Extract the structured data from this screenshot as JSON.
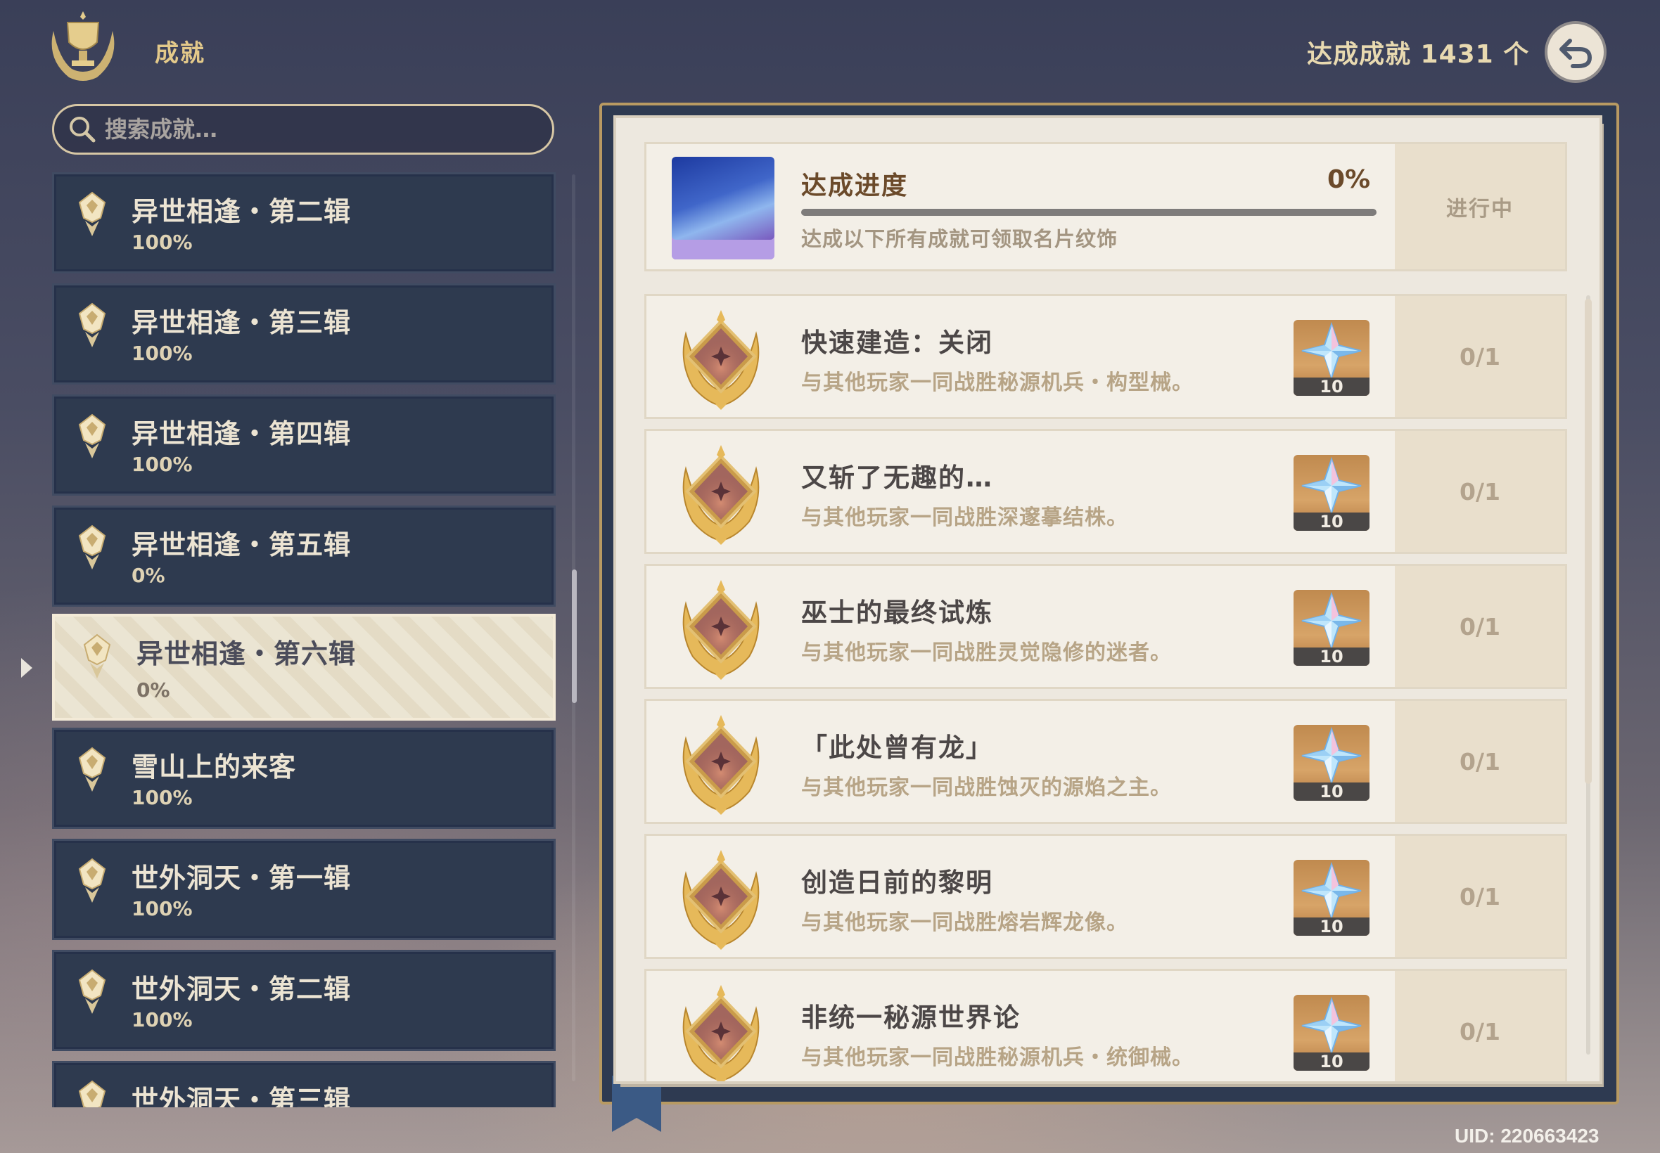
{
  "header": {
    "title": "成就",
    "total_label": "达成成就 1431 个"
  },
  "search": {
    "placeholder": "搜索成就…"
  },
  "categories": [
    {
      "name": "异世相逢・第二辑",
      "percent": "100%"
    },
    {
      "name": "异世相逢・第三辑",
      "percent": "100%"
    },
    {
      "name": "异世相逢・第四辑",
      "percent": "100%"
    },
    {
      "name": "异世相逢・第五辑",
      "percent": "0%"
    },
    {
      "name": "异世相逢・第六辑",
      "percent": "0%",
      "selected": true
    },
    {
      "name": "雪山上的来客",
      "percent": "100%"
    },
    {
      "name": "世外洞天・第一辑",
      "percent": "100%"
    },
    {
      "name": "世外洞天・第二辑",
      "percent": "100%"
    },
    {
      "name": "世外洞天・第三辑",
      "percent": ""
    }
  ],
  "progress": {
    "title": "达成进度",
    "percent": "0%",
    "progress_value": 0,
    "subtitle": "达成以下所有成就可领取名片纹饰",
    "status": "进行中"
  },
  "achievements": [
    {
      "title": "快速建造：关闭",
      "desc": "与其他玩家一同战胜秘源机兵・构型械。",
      "reward_qty": "10",
      "count": "0/1"
    },
    {
      "title": "又斩了无趣的…",
      "desc": "与其他玩家一同战胜深邃摹结株。",
      "reward_qty": "10",
      "count": "0/1"
    },
    {
      "title": "巫士的最终试炼",
      "desc": "与其他玩家一同战胜灵觉隐修的迷者。",
      "reward_qty": "10",
      "count": "0/1"
    },
    {
      "title": "「此处曾有龙」",
      "desc": "与其他玩家一同战胜蚀灭的源焰之主。",
      "reward_qty": "10",
      "count": "0/1"
    },
    {
      "title": "创造日前的黎明",
      "desc": "与其他玩家一同战胜熔岩辉龙像。",
      "reward_qty": "10",
      "count": "0/1"
    },
    {
      "title": "非统一秘源世界论",
      "desc": "与其他玩家一同战胜秘源机兵・统御械。",
      "reward_qty": "10",
      "count": "0/1"
    }
  ],
  "uid": "UID: 220663423",
  "icons": {
    "header": "trophy-icon",
    "search": "search-icon",
    "back": "back-arrow-icon",
    "reward": "primogem-icon",
    "medal": "achievement-medal-icon"
  },
  "colors": {
    "accent_gold": "#e3c98a",
    "panel_dark": "#2e3a4f",
    "page_bg": "#ede8df",
    "title_brown": "#6b4a2a"
  }
}
